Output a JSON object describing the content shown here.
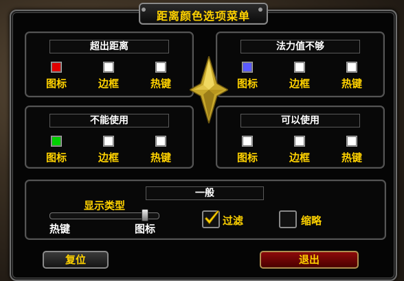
{
  "title": "距离颜色选项菜单",
  "panels": [
    {
      "title": "超出距离",
      "options": [
        {
          "label": "图标",
          "color": "#e00000"
        },
        {
          "label": "边框",
          "color": "#ffffff"
        },
        {
          "label": "热键",
          "color": "#ffffff"
        }
      ]
    },
    {
      "title": "法力值不够",
      "options": [
        {
          "label": "图标",
          "color": "#5a5aff"
        },
        {
          "label": "边框",
          "color": "#ffffff"
        },
        {
          "label": "热键",
          "color": "#ffffff"
        }
      ]
    },
    {
      "title": "不能使用",
      "options": [
        {
          "label": "图标",
          "color": "#00d000"
        },
        {
          "label": "边框",
          "color": "#ffffff"
        },
        {
          "label": "热键",
          "color": "#ffffff"
        }
      ]
    },
    {
      "title": "可以使用",
      "options": [
        {
          "label": "图标",
          "color": "#ffffff"
        },
        {
          "label": "边框",
          "color": "#ffffff"
        },
        {
          "label": "热键",
          "color": "#ffffff"
        }
      ]
    }
  ],
  "general": {
    "title": "一般",
    "display_type_label": "显示类型",
    "slider_left": "热键",
    "slider_right": "图标",
    "slider_value": 0.88,
    "filter": {
      "label": "过滤",
      "checked": true
    },
    "compact": {
      "label": "缩略",
      "checked": false
    }
  },
  "buttons": {
    "reset": "复位",
    "exit": "退出"
  }
}
